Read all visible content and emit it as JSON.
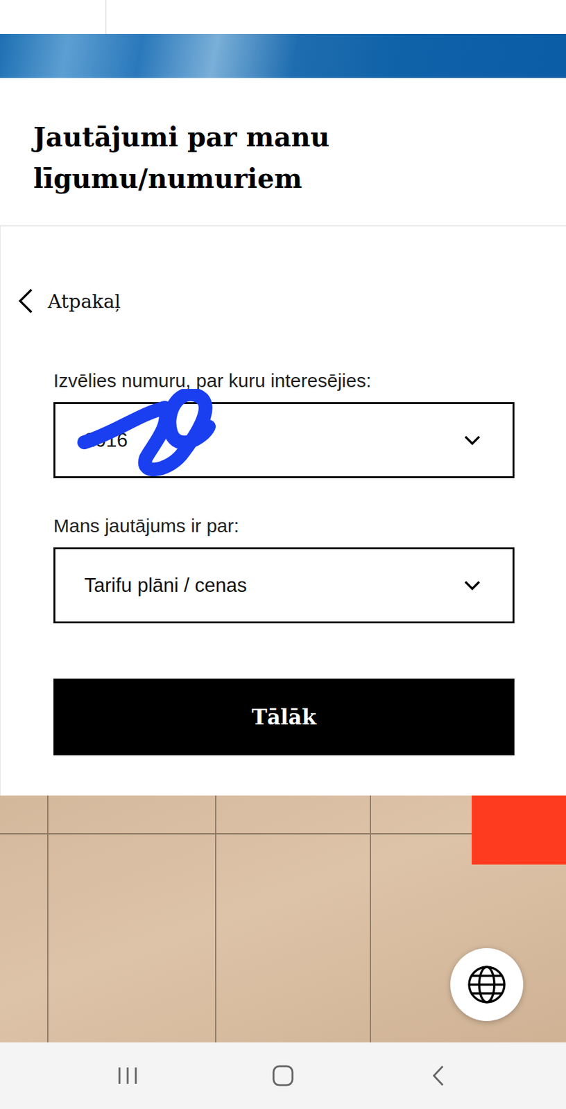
{
  "title": "Jautājumi par manu līgumu/numuriem",
  "back": {
    "label": "Atpakaļ"
  },
  "fields": [
    {
      "label": "Izvēlies numuru, par kuru interesējies:",
      "value": "2016",
      "redacted": true
    },
    {
      "label": "Mans jautājums ir par:",
      "value": "Tarifu plāni / cenas",
      "redacted": false
    }
  ],
  "submit": "Tālāk"
}
